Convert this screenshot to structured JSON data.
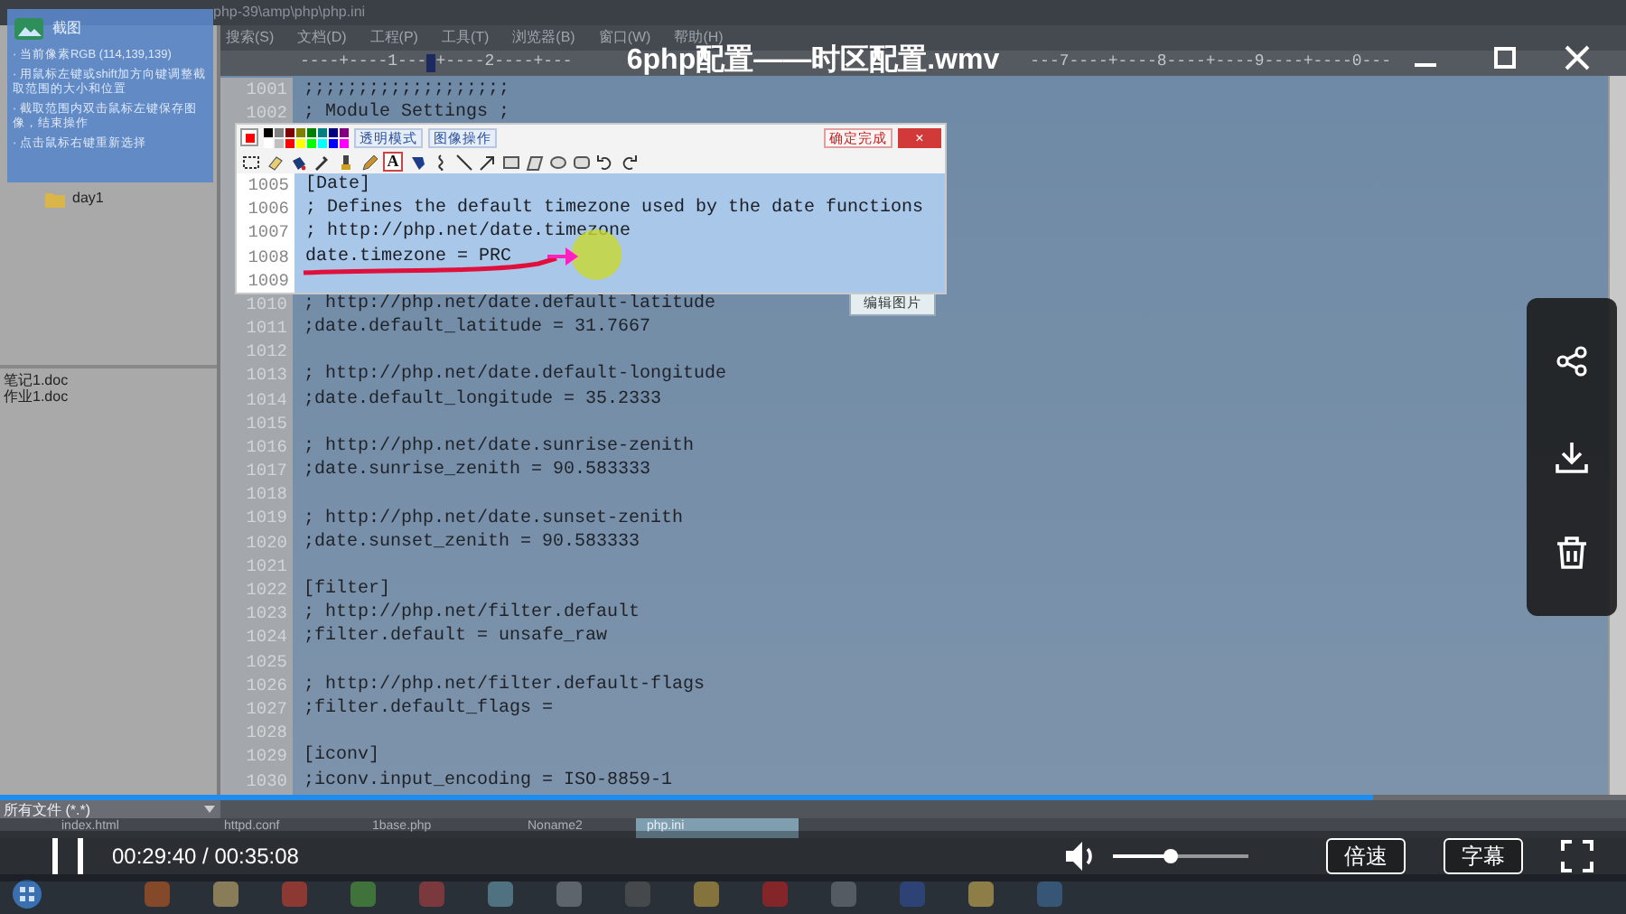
{
  "player": {
    "title": "6php配置——时区配置.wmv",
    "progress": {
      "level": 0.844
    },
    "time": "00:29:40 / 00:35:08",
    "volume": {
      "level": 0.43
    },
    "speed_button": "倍速",
    "subtitle_button": "字幕"
  },
  "video": {
    "window_title": "php-39\\amp\\php\\php.ini",
    "capture_tip": {
      "title": "截图",
      "tips": [
        "· 当前像素RGB (114,139,139)",
        "· 用鼠标左键或shift加方向键调整截取范围的大小和位置",
        "· 截取范围内双击鼠标左键保存图像，结束操作",
        "· 点击鼠标右键重新选择"
      ]
    },
    "folder": "day1",
    "files": [
      "笔记1.doc",
      "作业1.doc"
    ],
    "menu": [
      "搜索(S)",
      "文档(D)",
      "工程(P)",
      "工具(T)",
      "浏览器(B)",
      "窗口(W)",
      "帮助(H)"
    ],
    "ruler_left": "----+----1---",
    "ruler_mid": "+----2----+---",
    "ruler_right": "---7----+----8----+----9----+----0---",
    "code_top": [
      {
        "number": "1001",
        "text": ";;;;;;;;;;;;;;;;;;;"
      },
      {
        "number": "1002",
        "text": "; Module Settings ;"
      }
    ],
    "capture_toolbar": {
      "colors": [
        {
          "color": "#000000"
        },
        {
          "color": "#808080"
        },
        {
          "color": "#800000"
        },
        {
          "color": "#808000"
        },
        {
          "color": "#008000"
        },
        {
          "color": "#008080"
        },
        {
          "color": "#000080"
        },
        {
          "color": "#800080"
        },
        {
          "color": "#ffffff"
        },
        {
          "color": "#c0c0c0"
        },
        {
          "color": "#ff0000"
        },
        {
          "color": "#ffff00"
        },
        {
          "color": "#00ff00"
        },
        {
          "color": "#00ffff"
        },
        {
          "color": "#0000ff"
        },
        {
          "color": "#ff00ff"
        }
      ],
      "current_color": {
        "color": "#ff0000"
      },
      "buttons": [
        "透明模式",
        "图像操作"
      ],
      "done_button": "确定完成",
      "close_button": "×",
      "text_tool": "A",
      "lines": [
        {
          "number": "1005",
          "text": "[Date]"
        },
        {
          "number": "1006",
          "text": "; Defines the default timezone used by the date functions"
        },
        {
          "number": "1007",
          "text": "; http://php.net/date.timezone"
        },
        {
          "number": "1008",
          "text": "date.timezone = PRC"
        },
        {
          "number": "1009"
        }
      ]
    },
    "edit_image_button": "编辑图片",
    "code_bottom": [
      {
        "number": "1010",
        "text": "; http://php.net/date.default-latitude"
      },
      {
        "number": "1011",
        "text": ";date.default_latitude = 31.7667"
      },
      {
        "number": "1012"
      },
      {
        "number": "1013",
        "text": "; http://php.net/date.default-longitude"
      },
      {
        "number": "1014",
        "text": ";date.default_longitude = 35.2333"
      },
      {
        "number": "1015"
      },
      {
        "number": "1016",
        "text": "; http://php.net/date.sunrise-zenith"
      },
      {
        "number": "1017",
        "text": ";date.sunrise_zenith = 90.583333"
      },
      {
        "number": "1018"
      },
      {
        "number": "1019",
        "text": "; http://php.net/date.sunset-zenith"
      },
      {
        "number": "1020",
        "text": ";date.sunset_zenith = 90.583333"
      },
      {
        "number": "1021"
      },
      {
        "number": "1022",
        "text": "[filter]"
      },
      {
        "number": "1023",
        "text": "; http://php.net/filter.default"
      },
      {
        "number": "1024",
        "text": ";filter.default = unsafe_raw"
      },
      {
        "number": "1025"
      },
      {
        "number": "1026",
        "text": "; http://php.net/filter.default-flags"
      },
      {
        "number": "1027",
        "text": ";filter.default_flags ="
      },
      {
        "number": "1028"
      },
      {
        "number": "1029",
        "text": "[iconv]"
      },
      {
        "number": "1030",
        "text": ";iconv.input_encoding = ISO-8859-1"
      }
    ],
    "file_filter": "所有文件 (*.*)",
    "tabs": [
      {
        "label": "index.html",
        "selected": false
      },
      {
        "label": "httpd.conf",
        "selected": false
      },
      {
        "label": "1base.php",
        "selected": false
      },
      {
        "label": "Noname2",
        "selected": false
      },
      {
        "label": "php.ini",
        "selected": true
      }
    ]
  }
}
